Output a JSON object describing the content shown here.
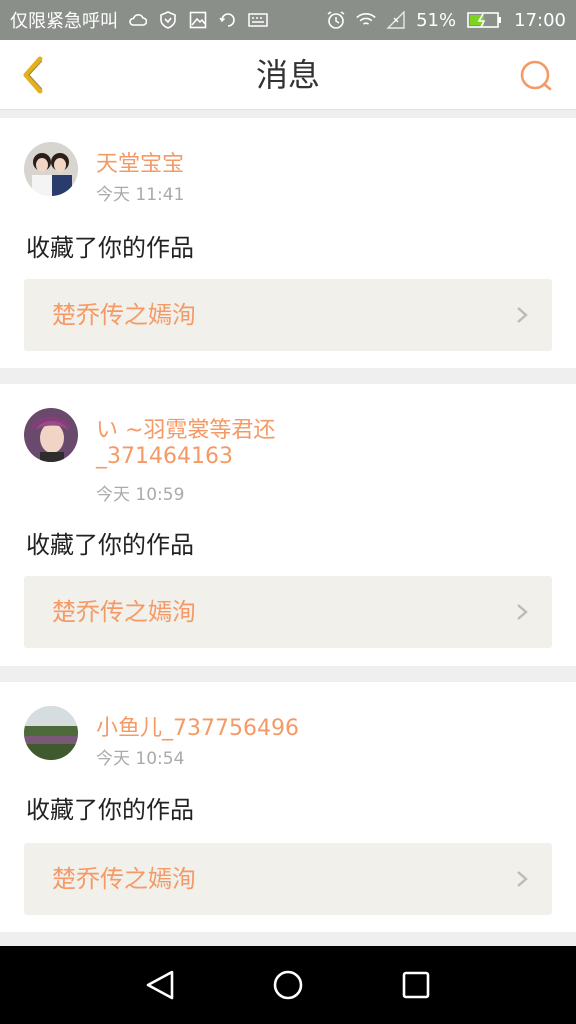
{
  "status_bar": {
    "carrier_text": "仅限紧急呼叫",
    "battery_percent": "51%",
    "time": "17:00"
  },
  "header": {
    "title": "消息"
  },
  "messages": [
    {
      "username": "天堂宝宝",
      "time": "今天 11:41",
      "action": "收藏了你的作品",
      "work_title": "楚乔传之嫣洵"
    },
    {
      "username": "い ~羽霓裳等君还",
      "username2": "_371464163",
      "time": "今天 10:59",
      "action": "收藏了你的作品",
      "work_title": "楚乔传之嫣洵"
    },
    {
      "username": "小鱼儿_737756496",
      "time": "今天 10:54",
      "action": "收藏了你的作品",
      "work_title": "楚乔传之嫣洵"
    }
  ],
  "icons": {
    "back": "chevron-left-icon",
    "chat": "chat-bubble-icon",
    "nav_back": "triangle-back-icon",
    "nav_home": "circle-home-icon",
    "nav_recent": "square-recent-icon"
  },
  "colors": {
    "accent": "#f59a66",
    "back_chevron": "#e5b01f",
    "status_bar": "#8a8f8a"
  }
}
